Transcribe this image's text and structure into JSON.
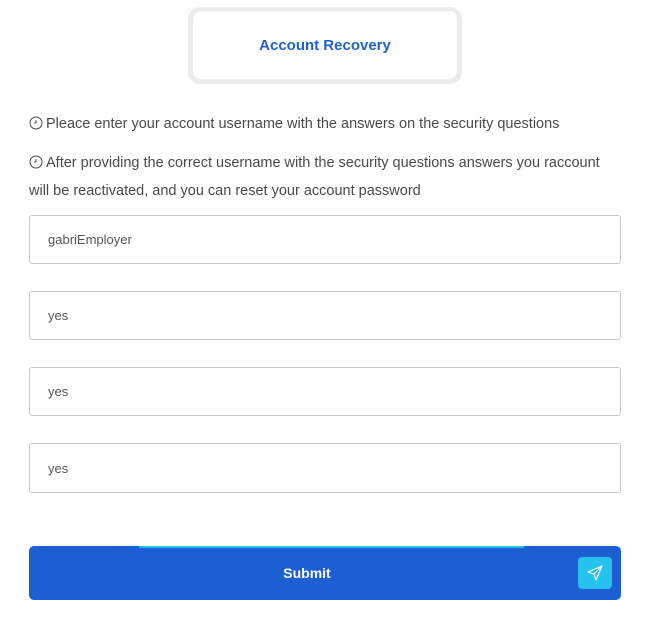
{
  "header": {
    "title": "Account Recovery"
  },
  "info": {
    "line1": "Pleace enter your account username with the answers on the security questions",
    "line2": "After providing the correct username with the security questions answers you raccount will be reactivated, and you can reset your account password",
    "icon": "clock-icon"
  },
  "form": {
    "username_value": "gabriEmployer",
    "answer1_value": "yes",
    "answer2_value": "yes",
    "answer3_value": "yes"
  },
  "submit": {
    "label": "Submit",
    "icon": "send-icon"
  },
  "colors": {
    "accent": "#1f62c9",
    "button": "#1c5fd2",
    "icon_box": "#27c1ee",
    "accent_line": "#1ec4e8"
  }
}
